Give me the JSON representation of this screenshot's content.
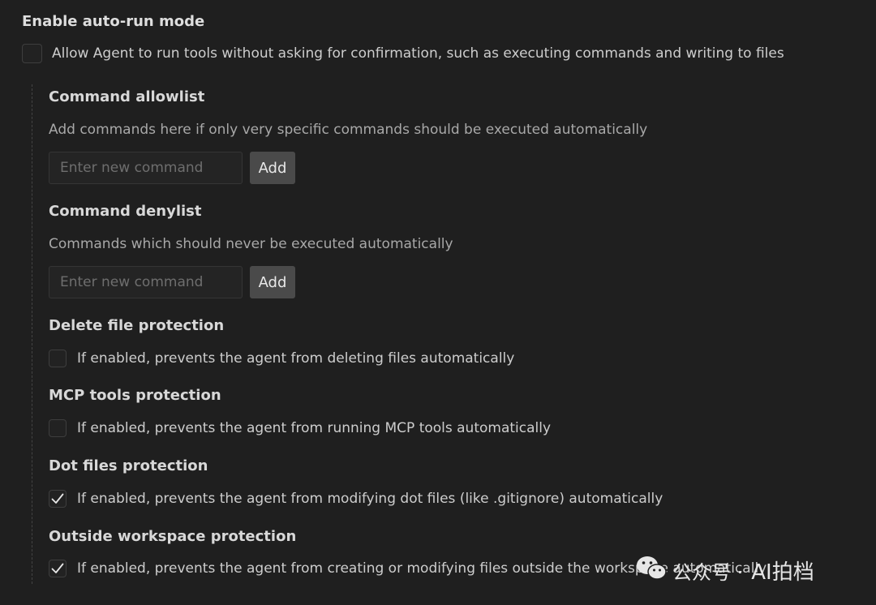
{
  "auto_run": {
    "title": "Enable auto-run mode",
    "checkbox_label": "Allow Agent to run tools without asking for confirmation, such as executing commands and writing to files",
    "checked": false
  },
  "allowlist": {
    "title": "Command allowlist",
    "description": "Add commands here if only very specific commands should be executed automatically",
    "input_placeholder": "Enter new command",
    "add_label": "Add"
  },
  "denylist": {
    "title": "Command denylist",
    "description": "Commands which should never be executed automatically",
    "input_placeholder": "Enter new command",
    "add_label": "Add"
  },
  "delete_protection": {
    "title": "Delete file protection",
    "label": "If enabled, prevents the agent from deleting files automatically",
    "checked": false
  },
  "mcp_protection": {
    "title": "MCP tools protection",
    "label": "If enabled, prevents the agent from running MCP tools automatically",
    "checked": false
  },
  "dotfiles_protection": {
    "title": "Dot files protection",
    "label": "If enabled, prevents the agent from modifying dot files (like .gitignore) automatically",
    "checked": true
  },
  "outside_workspace_protection": {
    "title": "Outside workspace protection",
    "label": "If enabled, prevents the agent from creating or modifying files outside the workspace automatically",
    "checked": true
  },
  "watermark": {
    "icon": "wechat-icon",
    "label": "公众号 ·",
    "brand": "AI拍档"
  },
  "colors": {
    "background": "#1f1f1f",
    "text": "#cfcfcf",
    "button": "#4a4a4a"
  }
}
